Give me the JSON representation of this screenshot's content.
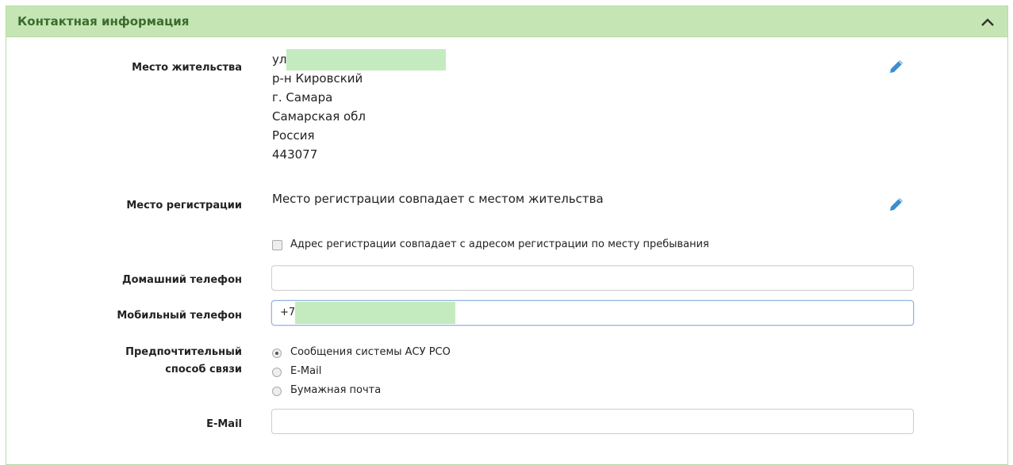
{
  "panel": {
    "title": "Контактная информация"
  },
  "residence": {
    "label": "Место жительства",
    "lines": [
      "ул.",
      "р-н Кировский",
      "г. Самара",
      "Самарская обл",
      "Россия",
      "443077"
    ]
  },
  "registration": {
    "label": "Место регистрации",
    "value": "Место регистрации совпадает с местом жительства",
    "same_address_checkbox": {
      "label": "Адрес регистрации совпадает с адресом регистрации по месту пребывания",
      "checked": false
    }
  },
  "home_phone": {
    "label": "Домашний телефон",
    "value": ""
  },
  "mobile_phone": {
    "label": "Мобильный телефон",
    "value": "+7-"
  },
  "contact_method": {
    "label_line1": "Предпочтительный",
    "label_line2": "способ связи",
    "options": [
      "Сообщения системы АСУ РСО",
      "E-Mail",
      "Бумажная почта"
    ],
    "selected_index": 0
  },
  "email": {
    "label": "E-Mail",
    "value": ""
  },
  "colors": {
    "header_bg": "#c5e6b4",
    "title": "#3c6b2e",
    "accent_icon": "#3d8ed0",
    "redaction": "#c4ebc0"
  }
}
